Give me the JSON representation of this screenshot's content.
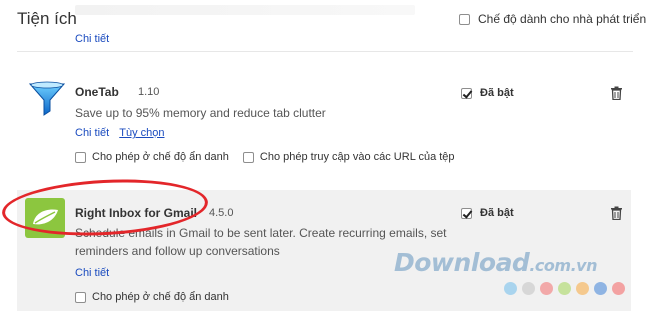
{
  "header": {
    "title": "Tiện ích",
    "developer_mode_label": "Chế độ dành cho nhà phát triển",
    "developer_mode_checked": false
  },
  "previous_extension": {
    "details_label": "Chi tiết"
  },
  "extensions": [
    {
      "name": "OneTab",
      "version": "1.10",
      "description": "Save up to 95% memory and reduce tab clutter",
      "details_label": "Chi tiết",
      "options_label": "Tùy chọn",
      "enabled_label": "Đã bật",
      "enabled": true,
      "allow_incognito_label": "Cho phép ở chế độ ẩn danh",
      "allow_file_urls_label": "Cho phép truy cập vào các URL của tệp",
      "icon": "onetab-funnel-icon"
    },
    {
      "name": "Right Inbox for Gmail",
      "version": "4.5.0",
      "description_line1": "Schedule emails in Gmail to be sent later. Create recurring emails, set",
      "description_line2": "reminders and follow up conversations",
      "details_label": "Chi tiết",
      "enabled_label": "Đã bật",
      "enabled": true,
      "allow_incognito_label": "Cho phép ở chế độ ẩn danh",
      "icon": "right-inbox-leaf-icon"
    }
  ],
  "watermark": {
    "brand": "Download",
    "suffix": ".com.vn"
  },
  "colors": {
    "link": "#1a4bbf",
    "annotation_red": "#e3262a",
    "highlight_bg": "#f1f1f1",
    "dots": [
      "#a9d4ee",
      "#d7d7d7",
      "#f2a9a9",
      "#c6e29c",
      "#f5c98e",
      "#8fb4e3",
      "#f3a2a2"
    ]
  }
}
